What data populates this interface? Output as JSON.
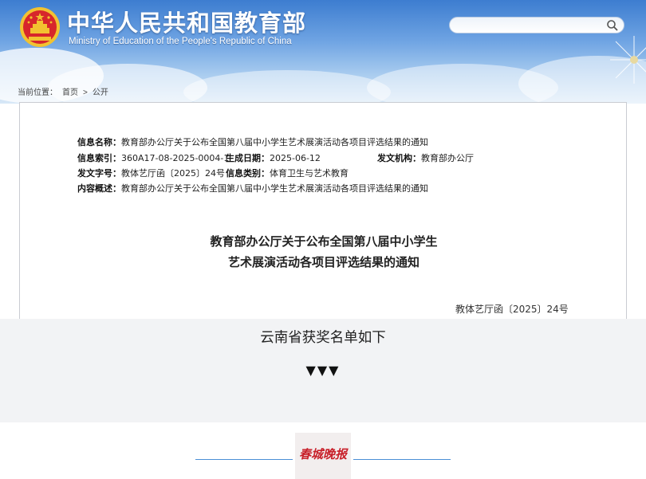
{
  "header": {
    "site_title": "中华人民共和国教育部",
    "site_subtitle": "Ministry of Education of the People's Republic of China",
    "search_placeholder": "",
    "colors": {
      "sky_top": "#3d7dd0",
      "sky_bottom": "#d8e8f7",
      "emblem_red": "#d7262b",
      "emblem_gold": "#f2c230"
    },
    "icons": {
      "search": "search-icon",
      "emblem": "national-emblem-icon",
      "decoration": "dandelion-icon"
    }
  },
  "breadcrumb": {
    "prefix": "当前位置：",
    "items": [
      "首页",
      "公开"
    ]
  },
  "document": {
    "meta": {
      "name_label": "信息名称：",
      "name_value": "教育部办公厅关于公布全国第八届中小学生艺术展演活动各项目评选结果的通知",
      "index_label": "信息索引：",
      "index_value": "360A17-08-2025-0004-1",
      "date_label": "生成日期：",
      "date_value": "2025-06-12",
      "issuer_label": "发文机构：",
      "issuer_value": "教育部办公厅",
      "docno_label": "发文字号：",
      "docno_value": "教体艺厅函〔2025〕24号",
      "category_label": "信息类别：",
      "category_value": "体育卫生与艺术教育",
      "summary_label": "内容概述：",
      "summary_value": "教育部办公厅关于公布全国第八届中小学生艺术展演活动各项目评选结果的通知"
    },
    "title_line1": "教育部办公厅关于公布全国第八届中小学生",
    "title_line2": "艺术展演活动各项目评选结果的通知",
    "doc_number": "教体艺厅函〔2025〕24号"
  },
  "band": {
    "text": "云南省获奖名单如下",
    "arrows": "▼▼▼",
    "background": "#f2f3f5"
  },
  "footer": {
    "logo_text": "春城晚报",
    "logo_icon": "newspaper-logo-icon",
    "rule_color": "#4a8fd6",
    "logo_color": "#c8202a"
  }
}
